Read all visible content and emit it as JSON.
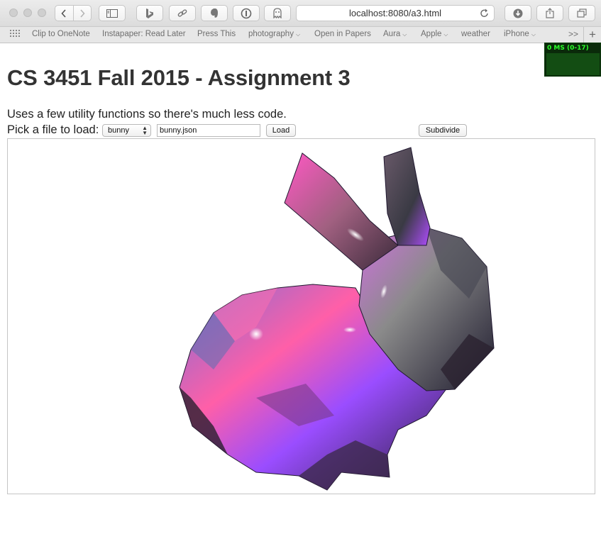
{
  "browser": {
    "url": "localhost:8080/a3.html",
    "bookmarks": [
      {
        "label": "Clip to OneNote",
        "menu": false
      },
      {
        "label": "Instapaper: Read Later",
        "menu": false
      },
      {
        "label": "Press This",
        "menu": false
      },
      {
        "label": "photography",
        "menu": true
      },
      {
        "label": "Open in Papers",
        "menu": false
      },
      {
        "label": "Aura",
        "menu": true
      },
      {
        "label": "Apple",
        "menu": true
      },
      {
        "label": "weather",
        "menu": false
      },
      {
        "label": "iPhone",
        "menu": true
      }
    ],
    "overflow_label": ">>",
    "new_tab_label": "+"
  },
  "page": {
    "title": "CS 3451 Fall 2015 - Assignment 3",
    "description": "Uses a few utility functions so there's much less code.",
    "pick_label": "Pick a file to load:",
    "file_select_value": "bunny",
    "file_input_value": "bunny.json",
    "load_button": "Load",
    "subdivide_button": "Subdivide"
  },
  "stats": {
    "label": "0 MS (0-17)"
  },
  "colors": {
    "mesh_pink": "#ff5fa8",
    "mesh_purple": "#9a4dff",
    "mesh_dark": "#1e1b2e",
    "mesh_gray": "#8a8a8a",
    "stats_text": "#2bff2b",
    "stats_bg": "#0a2a0a"
  }
}
